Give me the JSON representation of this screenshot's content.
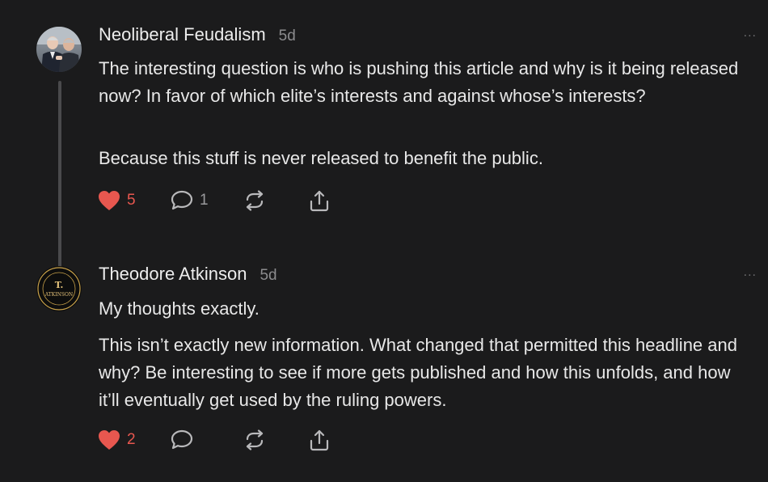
{
  "comments": [
    {
      "author": "Neoliberal Feudalism",
      "time": "5d",
      "paragraphs": [
        "The interesting question is who is pushing this article and why is it being released now? In favor of which elite’s interests and against whose’s interests?",
        "Because this stuff is never released to benefit the public."
      ],
      "likes": "5",
      "replies": "1",
      "more": "..."
    },
    {
      "author": "Theodore Atkinson",
      "time": "5d",
      "avatar_text": {
        "initial": "T.",
        "name": "ATKINSON"
      },
      "paragraphs": [
        "My thoughts exactly.",
        "This isn’t exactly new information. What changed that permitted this headline and why? Be interesting to see if more gets published and how this unfolds, and how it’ll eventually get used by the ruling powers."
      ],
      "likes": "2",
      "more": "..."
    }
  ],
  "icons": {
    "like": "heart-icon",
    "reply": "comment-bubble-icon",
    "restack": "restack-icon",
    "share": "share-icon",
    "more": "more-dots-icon"
  },
  "colors": {
    "background": "#1b1b1c",
    "like": "#e8574f",
    "icon": "#b9b9bb",
    "muted": "#8c8c8e"
  }
}
